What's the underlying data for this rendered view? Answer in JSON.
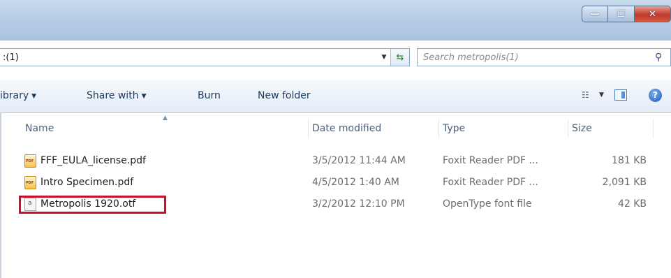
{
  "window": {
    "caption_buttons": [
      {
        "name": "minimize-icon",
        "glyph": "—"
      },
      {
        "name": "maximize-icon",
        "glyph": "☐"
      },
      {
        "name": "close-icon",
        "glyph": "✕"
      }
    ]
  },
  "address": {
    "text": ":(1)",
    "dropdown_icon": "chevron-down-icon",
    "refresh_icon": "refresh-icon"
  },
  "search": {
    "placeholder": "Search metropolis(1)",
    "icon": "search-icon"
  },
  "toolbar": {
    "items": [
      {
        "label": "ibrary",
        "has_dropdown": true
      },
      {
        "label": "Share with",
        "has_dropdown": true
      },
      {
        "label": "Burn",
        "has_dropdown": false
      },
      {
        "label": "New folder",
        "has_dropdown": false
      }
    ],
    "views_icon": "views-icon",
    "preview_pane_icon": "preview-pane-icon",
    "help_icon": "help-icon",
    "help_glyph": "?"
  },
  "columns": {
    "name": "Name",
    "date_modified": "Date modified",
    "type": "Type",
    "size": "Size"
  },
  "files": [
    {
      "name": "FFF_EULA_license.pdf",
      "date": "3/5/2012 11:44 AM",
      "type": "Foxit Reader PDF ...",
      "size": "181 KB",
      "icon": "pdf-file-icon"
    },
    {
      "name": "Intro Specimen.pdf",
      "date": "4/5/2012 1:40 AM",
      "type": "Foxit Reader PDF ...",
      "size": "2,091 KB",
      "icon": "pdf-file-icon"
    },
    {
      "name": "Metropolis 1920.otf",
      "date": "3/2/2012 12:10 PM",
      "type": "OpenType font file",
      "size": "42 KB",
      "icon": "font-file-icon",
      "highlighted": true
    }
  ],
  "colors": {
    "highlight": "#c8102e",
    "titlebar": "#b6cde6"
  }
}
